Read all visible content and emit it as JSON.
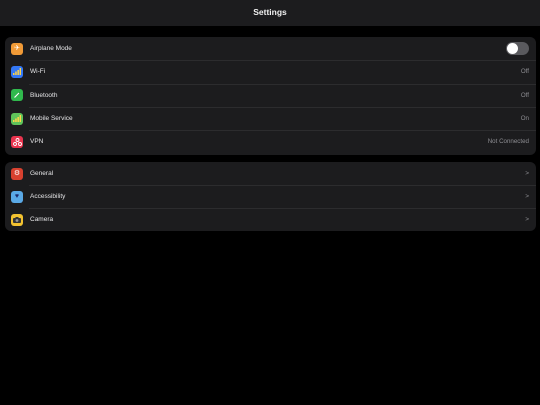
{
  "header": {
    "title": "Settings"
  },
  "connectivity": [
    {
      "label": "Airplane Mode",
      "icon": "airplane-icon",
      "glyph": "✈",
      "color": "#f09a37",
      "value": ""
    },
    {
      "label": "Wi-Fi",
      "icon": "wifi-icon",
      "glyph": "📶",
      "color": "#3478f6",
      "value": "Off"
    },
    {
      "label": "Bluetooth",
      "icon": "bluetooth-icon",
      "glyph": "✎",
      "color": "#30b94d",
      "value": "Off"
    },
    {
      "label": "Mobile Service",
      "icon": "antenna-icon",
      "glyph": "📶",
      "color": "#5fc35a",
      "value": "On"
    },
    {
      "label": "VPN",
      "icon": "vpn-icon",
      "glyph": "⚇",
      "color": "#e8344e",
      "value": "Not Connected"
    }
  ],
  "general": [
    {
      "label": "General",
      "icon": "gear-icon",
      "glyph": "⚙",
      "color": "#d8412f",
      "value": ">"
    },
    {
      "label": "Accessibility",
      "icon": "heart-icon",
      "glyph": "♥",
      "color": "#5aa9e6",
      "value": ">"
    },
    {
      "label": "Camera",
      "icon": "camera-icon",
      "glyph": "▣",
      "color": "#f2c230",
      "value": ">"
    }
  ],
  "airplane_mode_on": false,
  "colors": {
    "background": "#000000",
    "panel": "#1c1c1e"
  }
}
